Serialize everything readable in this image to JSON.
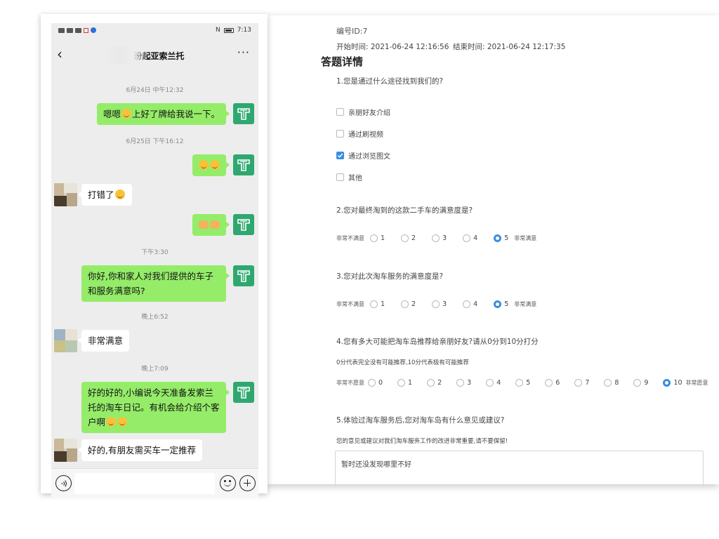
{
  "survey": {
    "cut_top_text": "编号ID:7",
    "start_time": "开始时间:  2021-06-24 12:16:56",
    "end_time": "结束时间:  2021-06-24 12:17:35",
    "section_title": "答题详情",
    "questions": [
      {
        "text": "1.您是通过什么途径找到我们的?",
        "options": [
          {
            "label": "亲朋好友介绍",
            "checked": false
          },
          {
            "label": "通过刷视频",
            "checked": false
          },
          {
            "label": "通过浏览图文",
            "checked": true
          },
          {
            "label": "其他",
            "checked": false
          }
        ]
      },
      {
        "text": "2.您对最终淘到的这款二手车的满意度是?",
        "low_label": "非常不满意",
        "high_label": "非常满意",
        "values": [
          "1",
          "2",
          "3",
          "4",
          "5"
        ],
        "selected": "5"
      },
      {
        "text": "3.您对此次淘车服务的满意度是?",
        "low_label": "非常不满意",
        "high_label": "非常满意",
        "values": [
          "1",
          "2",
          "3",
          "4",
          "5"
        ],
        "selected": "5"
      },
      {
        "text": "4.您有多大可能把淘车岛推荐给亲朋好友?请从0分到10分打分",
        "subtitle": "0分代表完全没有可能推荐,10分代表极有可能推荐",
        "low_label": "非常不愿意",
        "high_label": "非常愿意",
        "values": [
          "0",
          "1",
          "2",
          "3",
          "4",
          "5",
          "6",
          "7",
          "8",
          "9",
          "10"
        ],
        "selected": "10"
      },
      {
        "text": "5.体验过淘车服务后,您对淘车岛有什么意见或建议?",
        "subtitle": "您的意见或建议对我们淘车服务工作的改进非常重要,请不要保留!",
        "answer": "暂时还没发现哪里不好"
      }
    ]
  },
  "phone": {
    "status": {
      "time": "7:13",
      "nfc": "N"
    },
    "chat_title": "临汾起亚索兰托",
    "back_icon": "chevron-left-icon",
    "more_icon": "more-dots-icon",
    "timestamps": [
      "6月24日 中午12:32",
      "6月25日 下午16:12",
      "下午3:30",
      "晚上6:52",
      "晚上7:09"
    ],
    "messages": [
      {
        "from": "me",
        "text": "嗯嗯",
        "text_after": "上好了牌给我说一下。",
        "emoji": "smile-emoji"
      },
      {
        "from": "me",
        "emoji_only": "party-emoji"
      },
      {
        "from": "them",
        "text": "打错了",
        "emoji": "hot-face-emoji"
      },
      {
        "from": "me",
        "emoji_only": "handshake-emoji"
      },
      {
        "from": "me",
        "text": "你好,你和家人对我们提供的车子和服务满意吗?"
      },
      {
        "from": "them",
        "text": "非常满意"
      },
      {
        "from": "me",
        "text": "好的好的,小编说今天准备发索兰托的淘车日记。有机会给介绍个客户啊",
        "emoji": "grin-sweat-emoji"
      },
      {
        "from": "them",
        "text": "好的,有朋友需买车一定推荐"
      }
    ],
    "colors": {
      "my_bubble": "#95ec69",
      "their_bubble": "#ffffff",
      "avatar_brand": "#2fa870",
      "chat_bg": "#ededed"
    }
  }
}
